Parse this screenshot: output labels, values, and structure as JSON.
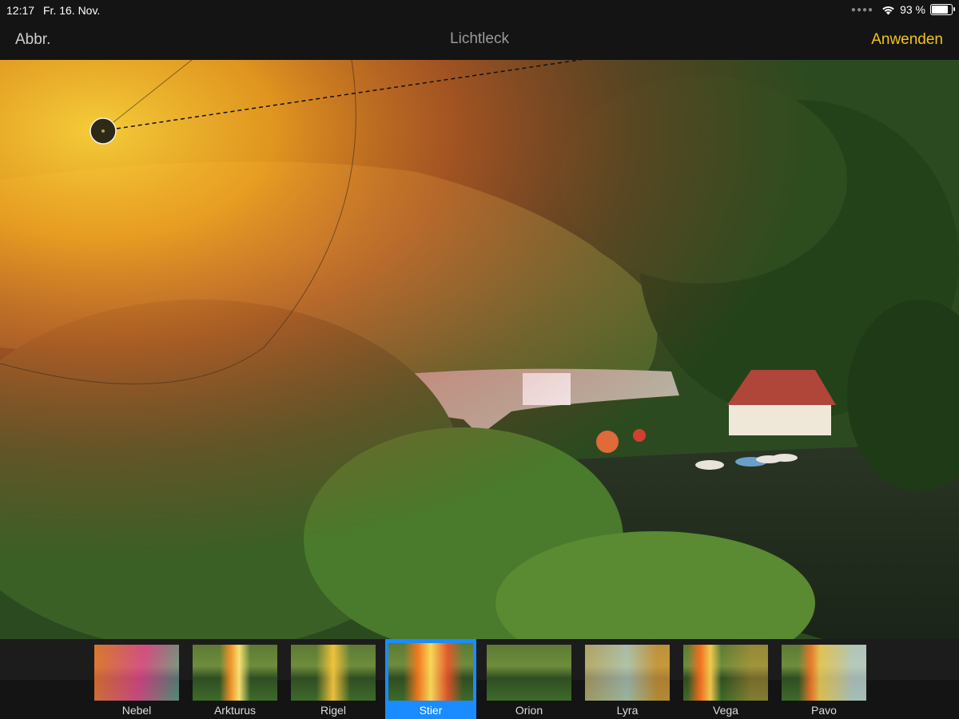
{
  "status_bar": {
    "time": "12:17",
    "date": "Fr. 16. Nov.",
    "battery_text": "93 %",
    "battery_level": 0.93
  },
  "nav": {
    "cancel_label": "Abbr.",
    "title": "Lichtleck",
    "apply_label": "Anwenden"
  },
  "filters": [
    {
      "label": "Nebel",
      "selected": false
    },
    {
      "label": "Arkturus",
      "selected": false
    },
    {
      "label": "Rigel",
      "selected": false
    },
    {
      "label": "Stier",
      "selected": true
    },
    {
      "label": "Orion",
      "selected": false
    },
    {
      "label": "Lyra",
      "selected": false
    },
    {
      "label": "Vega",
      "selected": false
    },
    {
      "label": "Pavo",
      "selected": false
    }
  ],
  "colors": {
    "accent_apply": "#f3c315",
    "selection": "#1a8cff",
    "flare_orange": "#ff8a1a",
    "flare_red": "#e8402a"
  }
}
